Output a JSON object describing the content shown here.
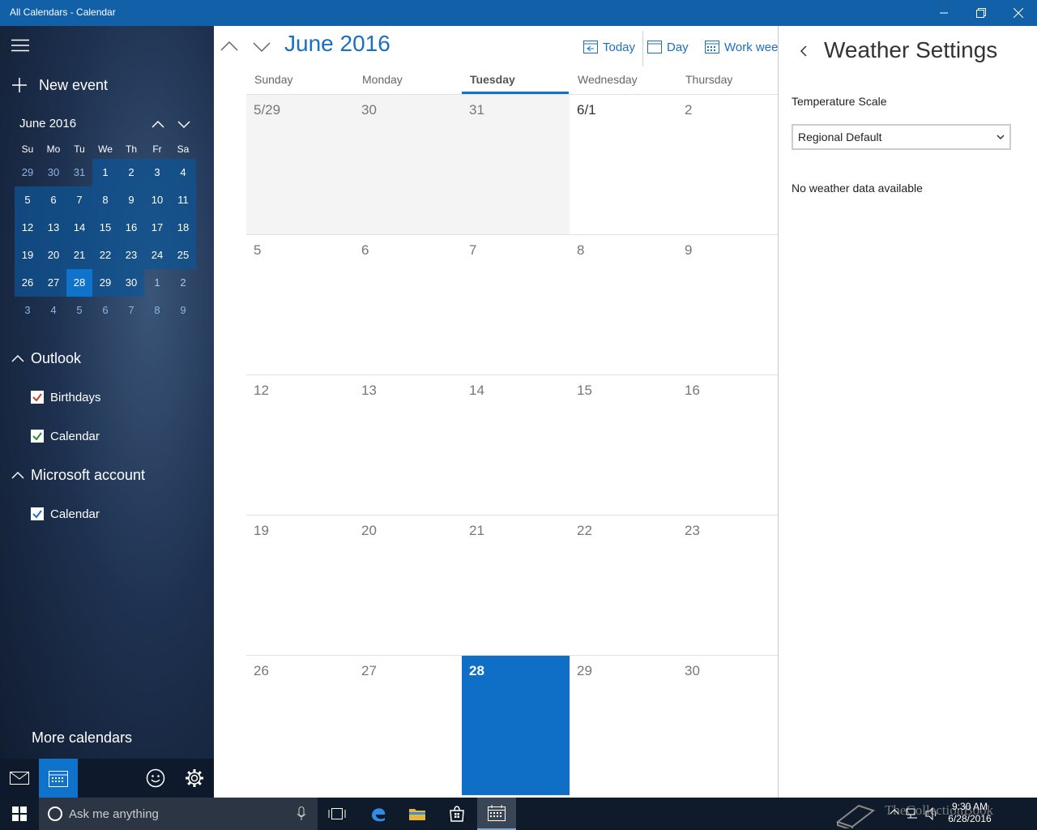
{
  "window": {
    "title": "All Calendars - Calendar"
  },
  "sidebar": {
    "new_event": "New event",
    "mini_calendar": {
      "title": "June 2016",
      "weekday_labels": [
        "Su",
        "Mo",
        "Tu",
        "We",
        "Th",
        "Fr",
        "Sa"
      ],
      "weeks": [
        [
          "29",
          "30",
          "31",
          "1",
          "2",
          "3",
          "4"
        ],
        [
          "5",
          "6",
          "7",
          "8",
          "9",
          "10",
          "11"
        ],
        [
          "12",
          "13",
          "14",
          "15",
          "16",
          "17",
          "18"
        ],
        [
          "19",
          "20",
          "21",
          "22",
          "23",
          "24",
          "25"
        ],
        [
          "26",
          "27",
          "28",
          "29",
          "30",
          "1",
          "2"
        ],
        [
          "3",
          "4",
          "5",
          "6",
          "7",
          "8",
          "9"
        ]
      ],
      "selected_day": "28"
    },
    "groups": [
      {
        "name": "Outlook",
        "calendars": [
          {
            "label": "Birthdays",
            "checked": true,
            "color": "#c94126"
          },
          {
            "label": "Calendar",
            "checked": true,
            "color": "#2d8a3a"
          }
        ]
      },
      {
        "name": "Microsoft account",
        "calendars": [
          {
            "label": "Calendar",
            "checked": true,
            "color": "#1f6fc6"
          }
        ]
      }
    ],
    "more_calendars": "More calendars"
  },
  "main": {
    "month_title": "June 2016",
    "toolbar": {
      "today": "Today",
      "day": "Day",
      "work_week": "Work week"
    },
    "day_headers": [
      "Sunday",
      "Monday",
      "Tuesday",
      "Wednesday",
      "Thursday"
    ],
    "weeks": [
      [
        "5/29",
        "30",
        "31",
        "6/1",
        "2"
      ],
      [
        "5",
        "6",
        "7",
        "8",
        "9"
      ],
      [
        "12",
        "13",
        "14",
        "15",
        "16"
      ],
      [
        "19",
        "20",
        "21",
        "22",
        "23"
      ],
      [
        "26",
        "27",
        "28",
        "29",
        "30"
      ]
    ],
    "today_label": "28"
  },
  "weather": {
    "title": "Weather Settings",
    "temperature_label": "Temperature Scale",
    "scale_value": "Regional Default",
    "no_data": "No weather data available"
  },
  "taskbar": {
    "search_placeholder": "Ask me anything",
    "time": "9:30 AM",
    "date": "6/28/2016",
    "watermark": "TheCollectionBook"
  },
  "colors": {
    "accent": "#0f73cc",
    "titlebar": "#1160a8",
    "taskbar": "#0f1b2a"
  }
}
